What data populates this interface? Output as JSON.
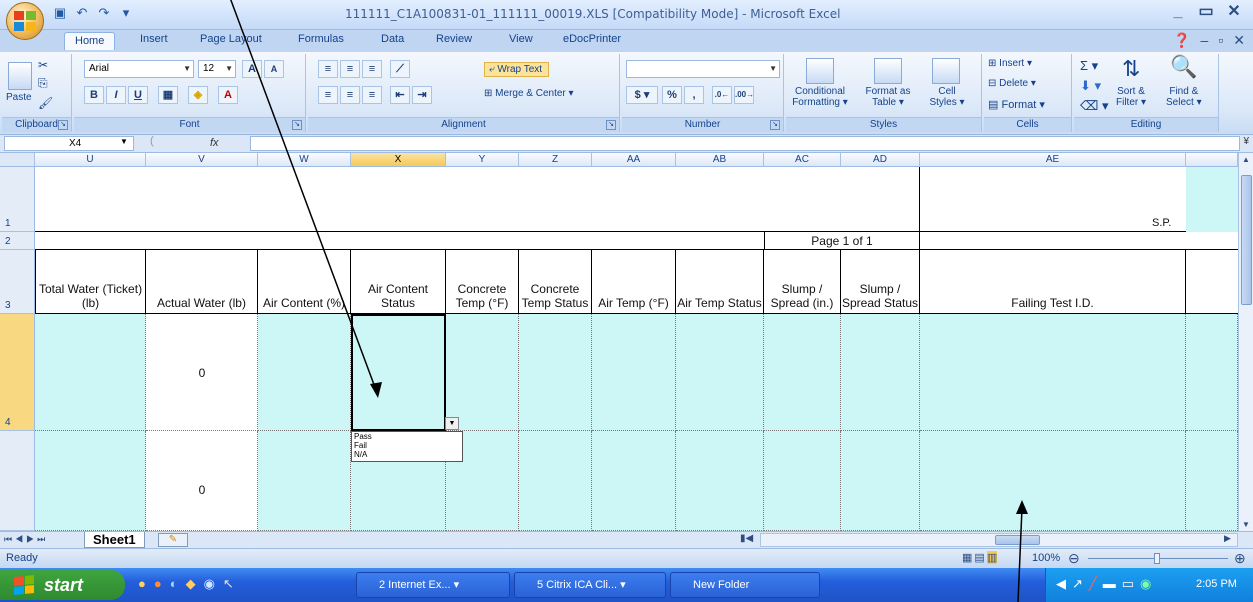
{
  "window": {
    "title": "111111_C1A100831-01_111111_00019.XLS  [Compatibility Mode] - Microsoft Excel"
  },
  "tabs": [
    "Home",
    "Insert",
    "Page Layout",
    "Formulas",
    "Data",
    "Review",
    "View",
    "eDocPrinter"
  ],
  "ribbon": {
    "clipboard": {
      "label": "Clipboard",
      "paste": "Paste"
    },
    "font": {
      "label": "Font",
      "name": "Arial",
      "size": "12"
    },
    "alignment": {
      "label": "Alignment",
      "wrap_text": "Wrap Text",
      "merge_center": "Merge & Center"
    },
    "number": {
      "label": "Number",
      "currency": "$",
      "percent": "%",
      "comma": ","
    },
    "styles": {
      "label": "Styles",
      "conditional": "Conditional",
      "formatting": "Formatting",
      "format_as": "Format as",
      "table": "Table",
      "cell": "Cell",
      "styles": "Styles"
    },
    "cells": {
      "label": "Cells",
      "insert": "Insert",
      "delete": "Delete",
      "format": "Format"
    },
    "editing": {
      "label": "Editing",
      "sort_filter": "Sort &",
      "filter": "Filter",
      "find_select": "Find &",
      "select": "Select"
    }
  },
  "formula_bar": {
    "name_box": "X4",
    "fx": "fx",
    "value": ""
  },
  "columns": [
    "U",
    "V",
    "W",
    "X",
    "Y",
    "Z",
    "AA",
    "AB",
    "AC",
    "AD",
    "AE"
  ],
  "rows": [
    "1",
    "2",
    "3",
    "4"
  ],
  "sheet": {
    "sp_label": "S.P.",
    "page_label": "Page 1 of 1",
    "headers": [
      "Total Water (Ticket) (lb)",
      "Actual Water (lb)",
      "Air Content (%)",
      "Air Content Status",
      "Concrete Temp (°F)",
      "Concrete Temp Status",
      "Air Temp (°F)",
      "Air Temp Status",
      "Slump / Spread (in.)",
      "Slump / Spread Status",
      "Failing Test I.D."
    ],
    "row4_actual_water": "0",
    "row5_actual_water": "0",
    "dropdown_options": [
      "Pass",
      "Fail",
      "N/A"
    ]
  },
  "sheet_tabs": [
    "Sheet1"
  ],
  "status": {
    "left": "Ready",
    "zoom": "100%"
  },
  "taskbar": {
    "start": "start",
    "items": [
      "2 Internet Ex...",
      "5 Citrix ICA Cli...",
      "New Folder"
    ],
    "clock": "2:05 PM"
  },
  "colors": {
    "cell_fill": "#cdf6f7",
    "selected_header": "#f6c958",
    "taskbar": "#245edb"
  }
}
